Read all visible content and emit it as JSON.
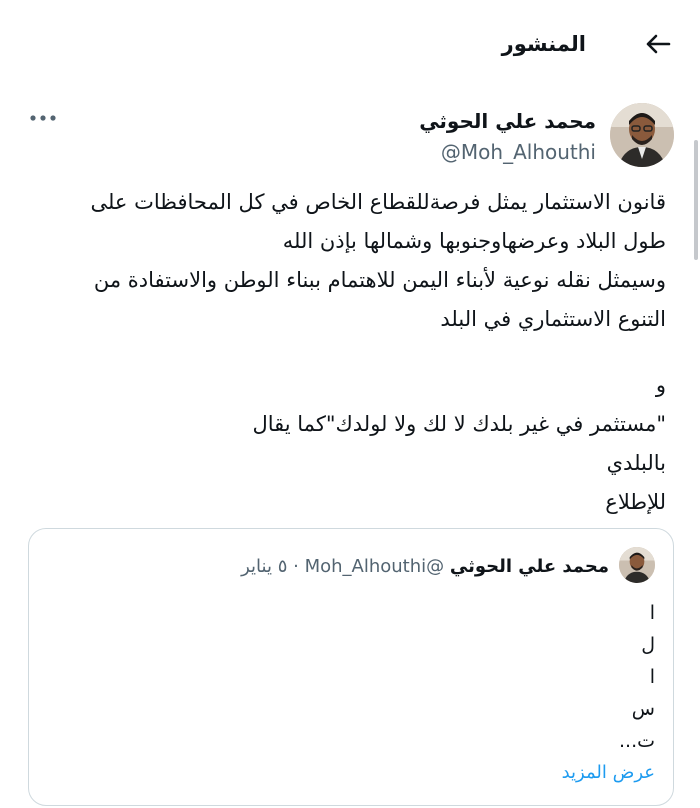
{
  "header": {
    "title": "المنشور",
    "back_icon": "arrow-back-icon"
  },
  "post": {
    "author_name": "محمد علي الحوثي",
    "author_handle": "@Moh_Alhouthi",
    "more_icon": "more-horizontal-icon",
    "text_lines": [
      "قانون الاستثمار يمثل فرصةللقطاع الخاص في كل المحافظات على",
      "طول البلاد وعرضهاوجنوبها وشمالها بإذن الله",
      "وسيمثل نقله نوعية لأبناء اليمن للاهتمام ببناء الوطن والاستفادة من",
      "التنوع الاستثماري في البلد",
      "و",
      "\"مستثمر في غير بلدك لا لك ولا لولدك\"كما يقال",
      "بالبلدي",
      "للإطلاع"
    ]
  },
  "quoted_post": {
    "author_name": "محمد علي الحوثي",
    "author_handle": "@Moh_Alhouthi",
    "separator": "·",
    "date": "٥ يناير",
    "lines": [
      "ا",
      "ل",
      "ا",
      "س",
      "ت..."
    ],
    "show_more_label": "عرض المزيد"
  },
  "colors": {
    "text": "#0f1419",
    "secondary": "#536471",
    "link": "#1d9bf0",
    "border": "#cfd9de"
  }
}
